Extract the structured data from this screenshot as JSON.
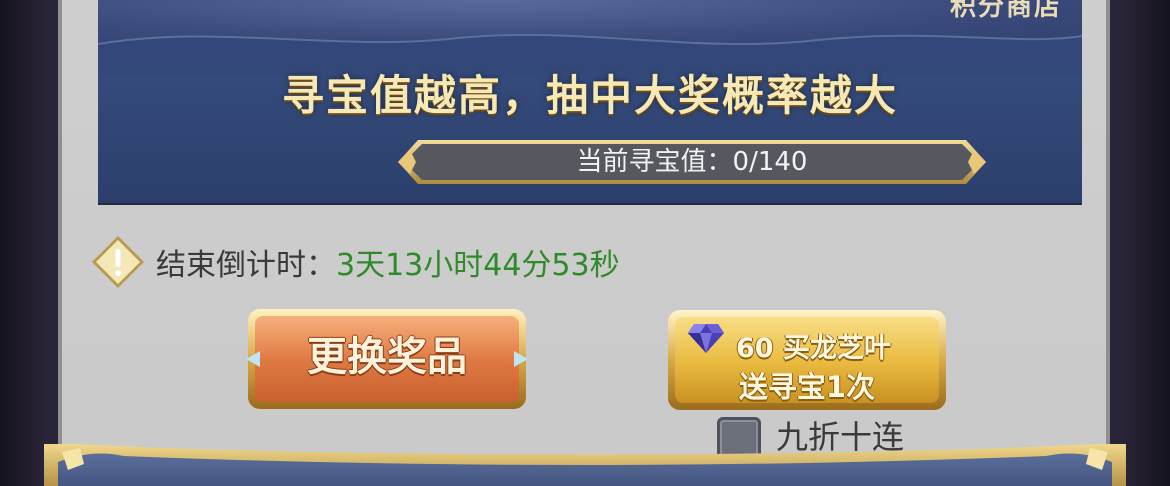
{
  "banner": {
    "corner_text": "积分商店",
    "headline": "寻宝值越高，抽中大奖概率越大",
    "value_label": "当前寻宝值：0/140"
  },
  "countdown": {
    "label": "结束倒计时：",
    "value": "3天13小时44分53秒",
    "value_color": "#2f8a2a",
    "icon": "warning-diamond-icon"
  },
  "buttons": {
    "change_prize": "更换奖品",
    "buy_line1": "60 买龙芝叶",
    "buy_line2": "送寻宝1次",
    "buy_icon": "diamond-gem-icon"
  },
  "option": {
    "label": "九折十连",
    "checked": false
  }
}
